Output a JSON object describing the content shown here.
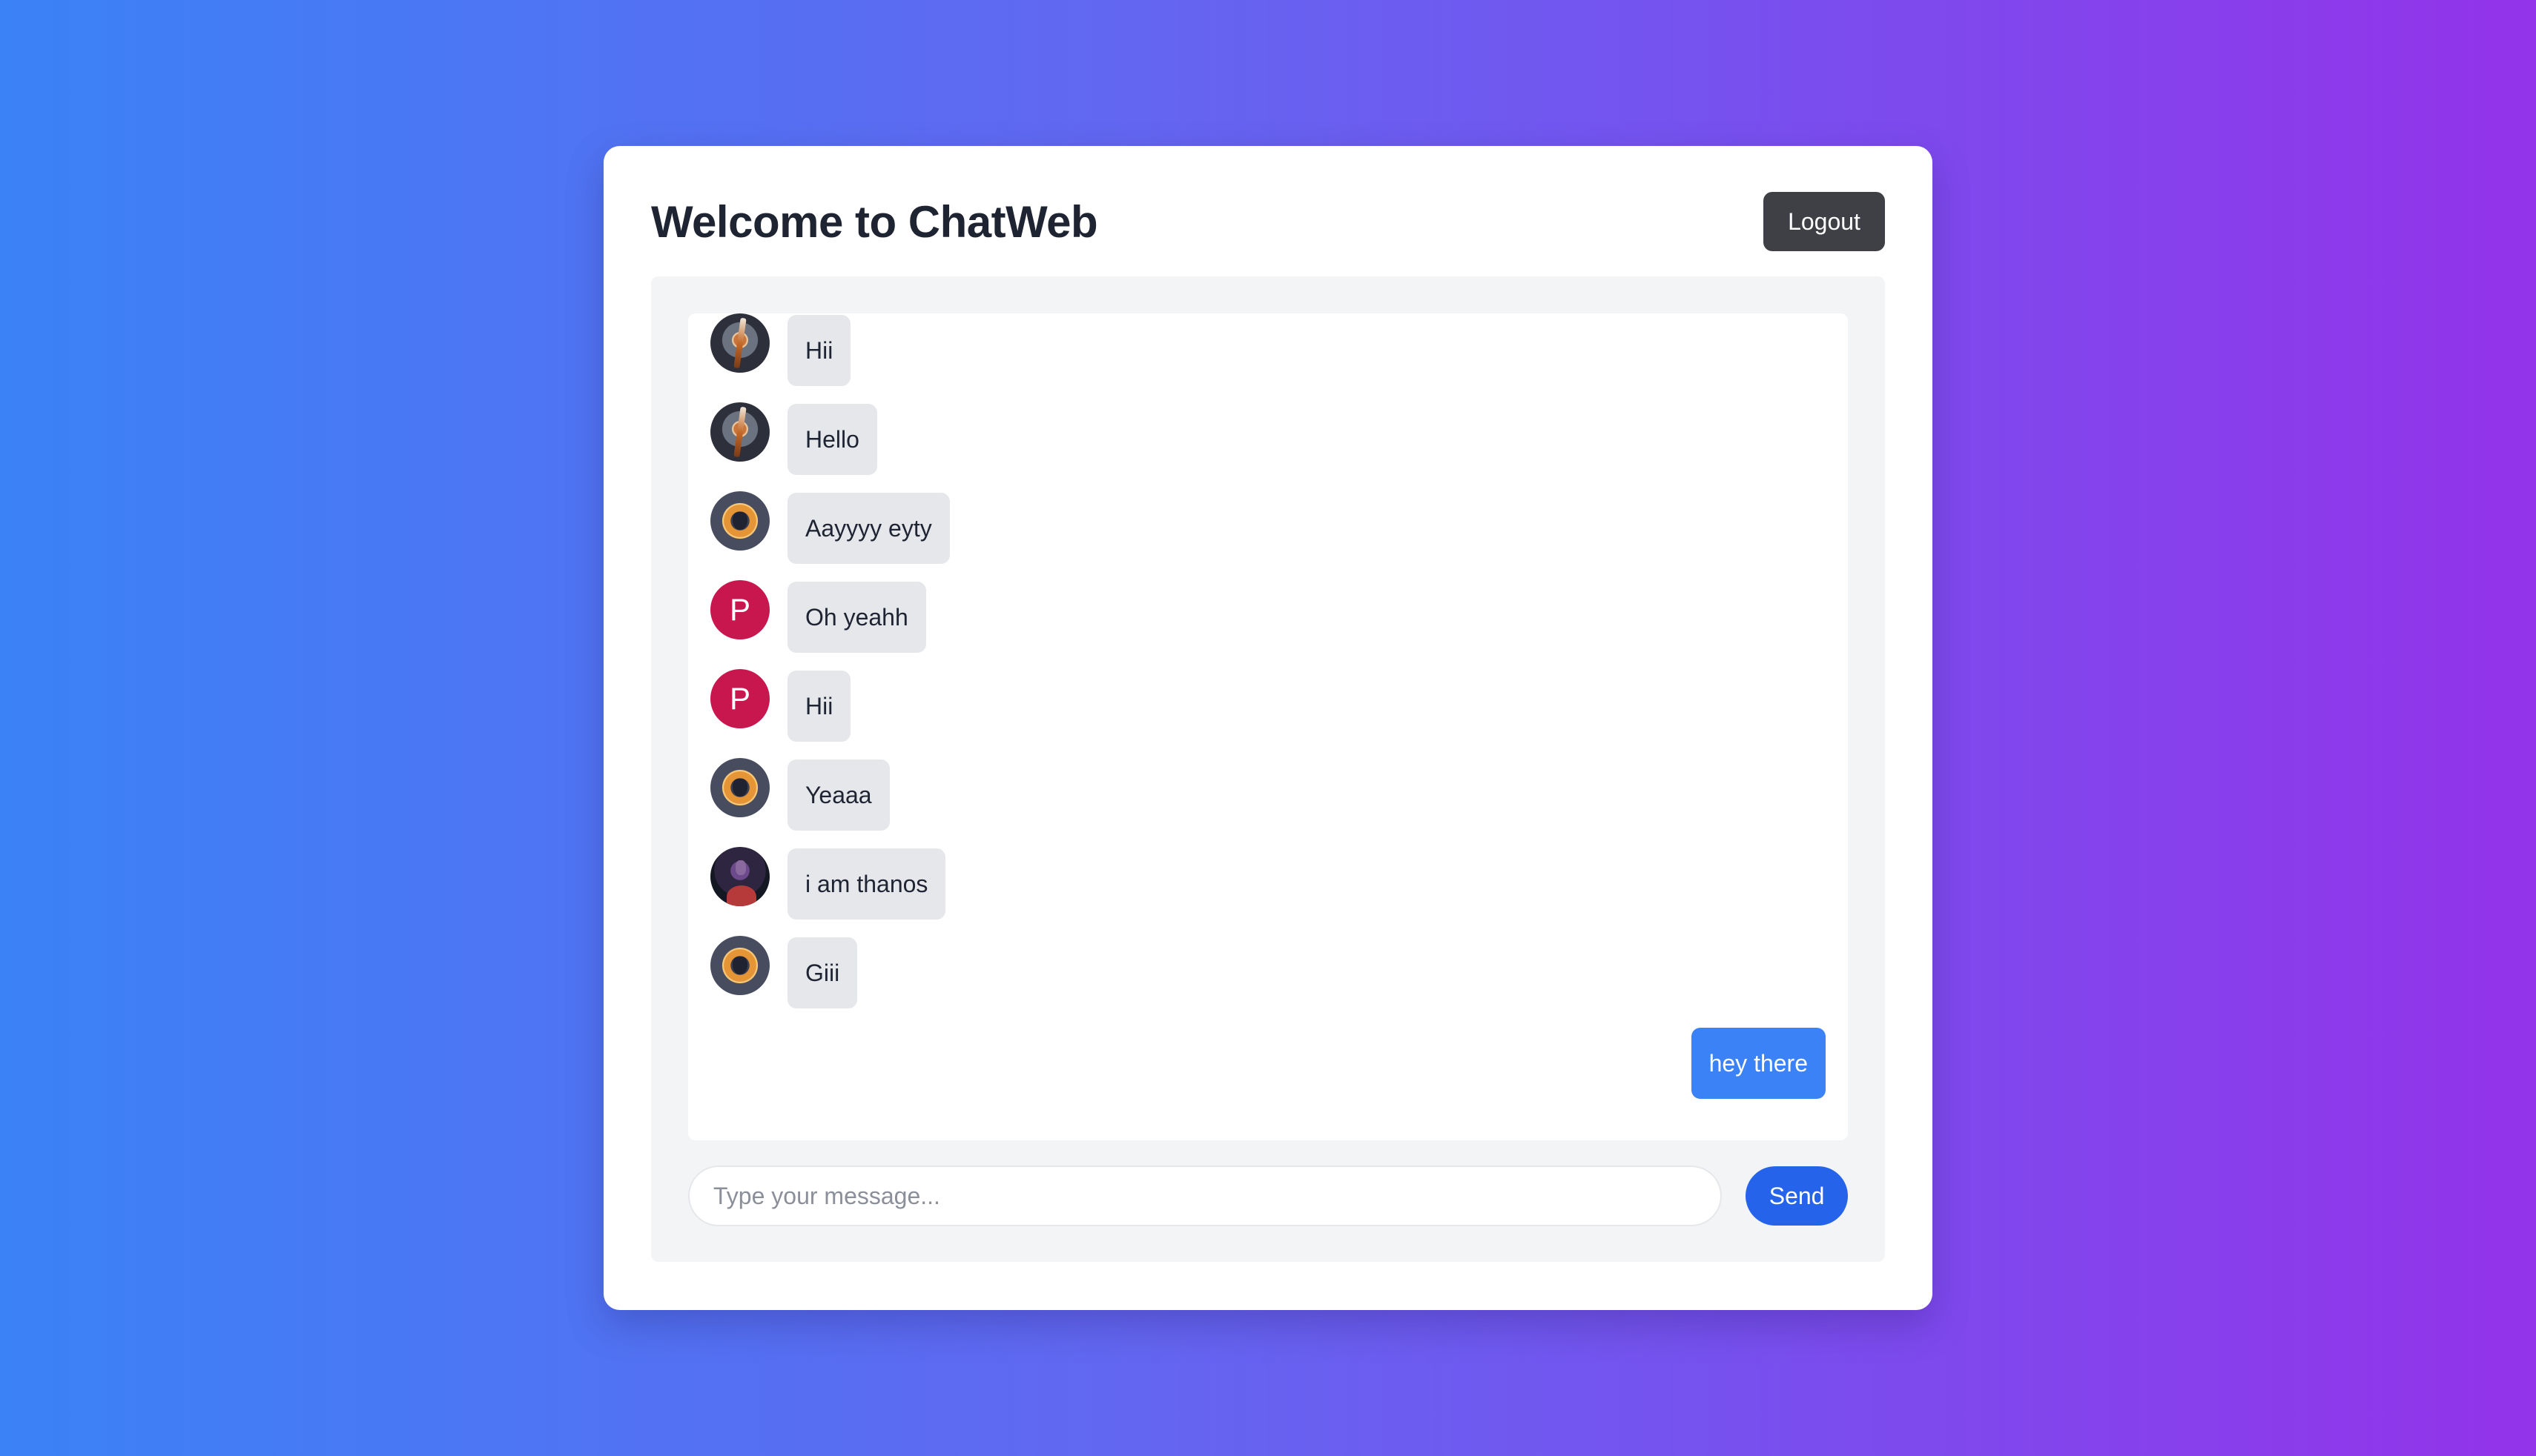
{
  "app": {
    "title": "Welcome to ChatWeb",
    "logout_label": "Logout"
  },
  "messages": [
    {
      "text": "Hii",
      "avatar": "warrior-avatar"
    },
    {
      "text": "Hello",
      "avatar": "warrior-avatar"
    },
    {
      "text": "Aayyyy eyty",
      "avatar": "helmet-avatar"
    },
    {
      "text": "Oh yeahh",
      "avatar": "letter-avatar",
      "initial": "P"
    },
    {
      "text": "Hii",
      "avatar": "letter-avatar",
      "initial": "P"
    },
    {
      "text": "Yeaaa",
      "avatar": "helmet-avatar"
    },
    {
      "text": "i am thanos",
      "avatar": "thanos-avatar"
    },
    {
      "text": "Giii",
      "avatar": "helmet-avatar"
    }
  ],
  "sent_message": {
    "text": "hey there"
  },
  "composer": {
    "placeholder": "Type your message...",
    "value": "",
    "send_label": "Send"
  },
  "colors": {
    "gradient_start": "#3b82f6",
    "gradient_end": "#9333ea",
    "sent_bubble": "#3b82f6",
    "send_button": "#2563eb",
    "logout_button": "#3f3f46",
    "letter_avatar": "#c8164f"
  }
}
